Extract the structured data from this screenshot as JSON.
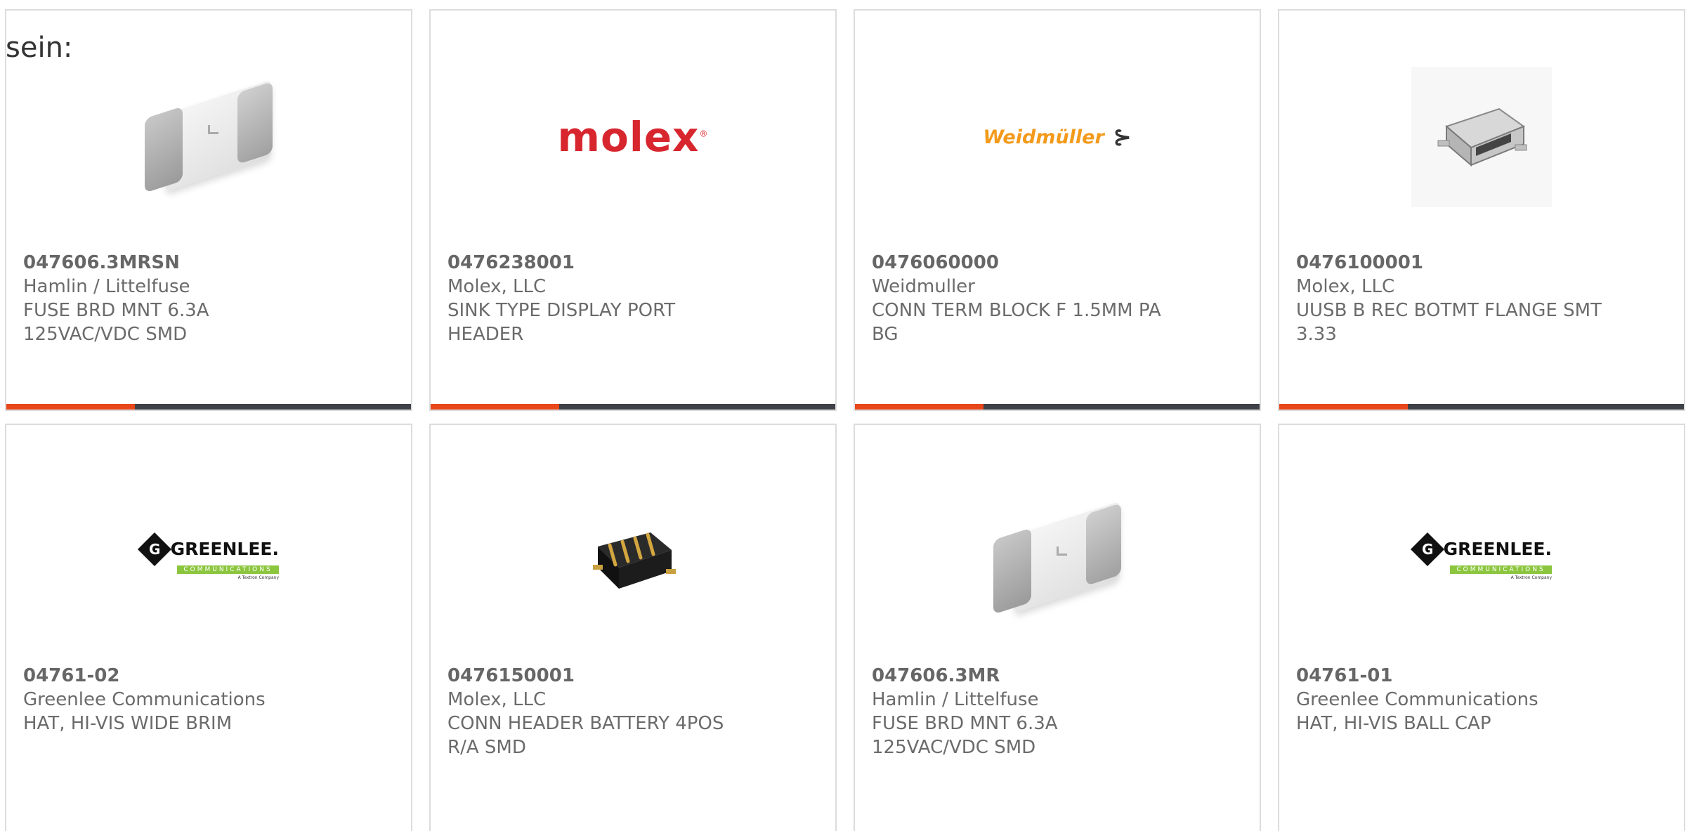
{
  "intro_text": "sein:",
  "colors": {
    "accent": "#e8471b",
    "bar": "#3e4145",
    "border": "#dcdcdc",
    "molex": "#d8262e",
    "weidmuller": "#f39a1b",
    "greenlee_green": "#8cc63f"
  },
  "products": [
    {
      "part_number": "047606.3MRSN",
      "manufacturer": "Hamlin / Littelfuse",
      "desc_line1": "FUSE BRD MNT 6.3A",
      "desc_line2": "125VAC/VDC SMD",
      "image": "fuse-image"
    },
    {
      "part_number": "0476238001",
      "manufacturer": "Molex, LLC",
      "desc_line1": "SINK TYPE DISPLAY PORT",
      "desc_line2": "HEADER",
      "image": "molex-logo",
      "logo_text": "molex"
    },
    {
      "part_number": "0476060000",
      "manufacturer": "Weidmuller",
      "desc_line1": "CONN TERM BLOCK F 1.5MM PA",
      "desc_line2": "BG",
      "image": "weidmuller-logo",
      "logo_text": "Weidmüller"
    },
    {
      "part_number": "0476100001",
      "manufacturer": "Molex, LLC",
      "desc_line1": "UUSB B REC BOTMT FLANGE SMT",
      "desc_line2": "3.33",
      "image": "usb-connector-image"
    },
    {
      "part_number": "04761-02",
      "manufacturer": "Greenlee Communications",
      "desc_line1": "HAT, HI-VIS WIDE BRIM",
      "desc_line2": "",
      "image": "greenlee-logo",
      "logo_word": "GREENLEE.",
      "logo_sub": "COMMUNICATIONS",
      "logo_tag": "A Textron Company"
    },
    {
      "part_number": "0476150001",
      "manufacturer": "Molex, LLC",
      "desc_line1": "CONN HEADER BATTERY 4POS",
      "desc_line2": "R/A SMD",
      "image": "battery-header-image"
    },
    {
      "part_number": "047606.3MR",
      "manufacturer": "Hamlin / Littelfuse",
      "desc_line1": "FUSE BRD MNT 6.3A",
      "desc_line2": "125VAC/VDC SMD",
      "image": "fuse-image"
    },
    {
      "part_number": "04761-01",
      "manufacturer": "Greenlee Communications",
      "desc_line1": "HAT, HI-VIS BALL CAP",
      "desc_line2": "",
      "image": "greenlee-logo",
      "logo_word": "GREENLEE.",
      "logo_sub": "COMMUNICATIONS",
      "logo_tag": "A Textron Company"
    }
  ]
}
